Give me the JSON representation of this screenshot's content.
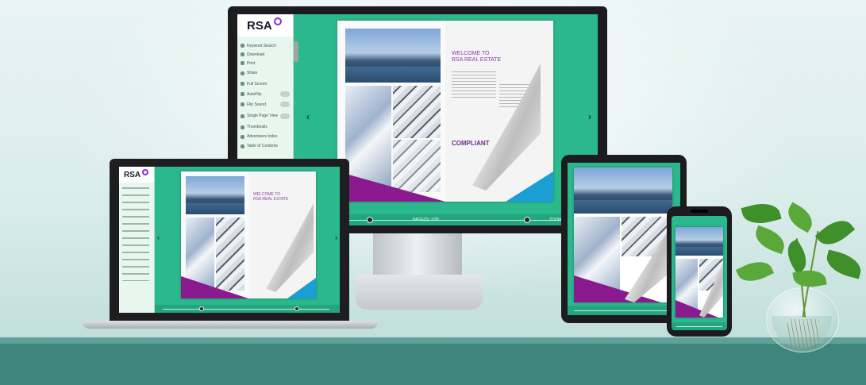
{
  "brand": {
    "logo_text": "RSA"
  },
  "menu": {
    "items": [
      {
        "label": "Keyword Search",
        "icon": "search-icon"
      },
      {
        "label": "Download",
        "icon": "download-icon"
      },
      {
        "label": "Print",
        "icon": "print-icon"
      },
      {
        "label": "Share",
        "icon": "share-icon"
      },
      {
        "label": "Full Screen",
        "icon": "fullscreen-icon"
      },
      {
        "label": "AutoFlip",
        "icon": "autoflip-icon",
        "toggle": true
      },
      {
        "label": "Flip Sound",
        "icon": "sound-icon",
        "toggle": true
      },
      {
        "label": "Single Page View",
        "icon": "single-page-icon",
        "toggle": true
      },
      {
        "label": "Thumbnails",
        "icon": "thumbnails-icon"
      },
      {
        "label": "Advertisers Index",
        "icon": "index-icon"
      },
      {
        "label": "Table of Contents",
        "icon": "toc-icon"
      }
    ]
  },
  "book": {
    "welcome_line1": "WELCOME TO",
    "welcome_line2": "RSA REAL ESTATE",
    "word_cloud": "COMPLIANT",
    "page_label": "PAGE(S): 2/28",
    "zoom_label": "ZOOM"
  },
  "colors": {
    "accent_green": "#2bb88c",
    "purple": "#8b1a8f",
    "cyan": "#1a9ed4"
  }
}
